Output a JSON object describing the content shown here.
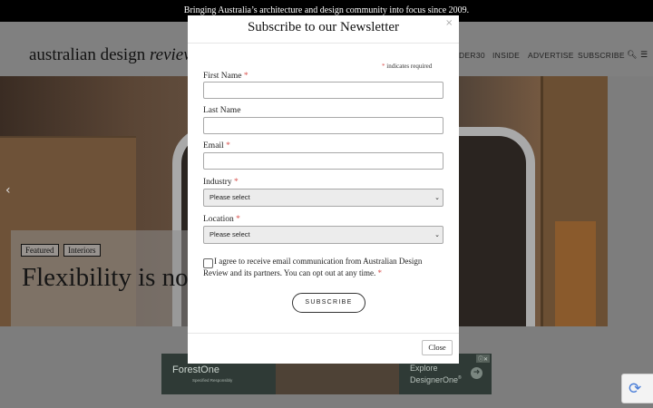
{
  "topbar": {
    "text": "Bringing Australia’s architecture and design community into focus since 2009."
  },
  "header": {
    "logo_main": "australian design ",
    "logo_italic": "review",
    "nav": [
      "DER30",
      "INSIDE",
      "ADVERTISE",
      "SUBSCRIBE"
    ],
    "search_icon": "search-icon",
    "menu_icon": "hamburger-menu-icon"
  },
  "hero": {
    "tags": [
      "Featured",
      "Interiors"
    ],
    "title": "Flexibility is no",
    "arrow_icon": "chevron-left-icon"
  },
  "modal": {
    "title": "Subscribe to our Newsletter",
    "close_x": "×",
    "required_note": "indicates required",
    "asterisk": "*",
    "fields": {
      "first_name": "First Name",
      "last_name": "Last Name",
      "email": "Email",
      "industry": "Industry",
      "location": "Location"
    },
    "industry_selected": "Please select",
    "location_selected": "Please select",
    "consent": "I agree to receive email communication from Australian Design Review and its partners. You can opt out at any time.",
    "subscribe_label": "SUBSCRIBE",
    "close_label": "Close"
  },
  "ad": {
    "brand": "ForestOne",
    "brand_sub": "Specified Responsibly",
    "cta_line1": "Explore",
    "cta_line2": "DesignerOne",
    "cta_sup": "®",
    "badge": "ⓘ✕",
    "arrow_icon": "arrow-right-icon"
  },
  "colors": {
    "required": "#d9534f",
    "overlay": "#7d7d7d",
    "topbar": "#000000"
  }
}
